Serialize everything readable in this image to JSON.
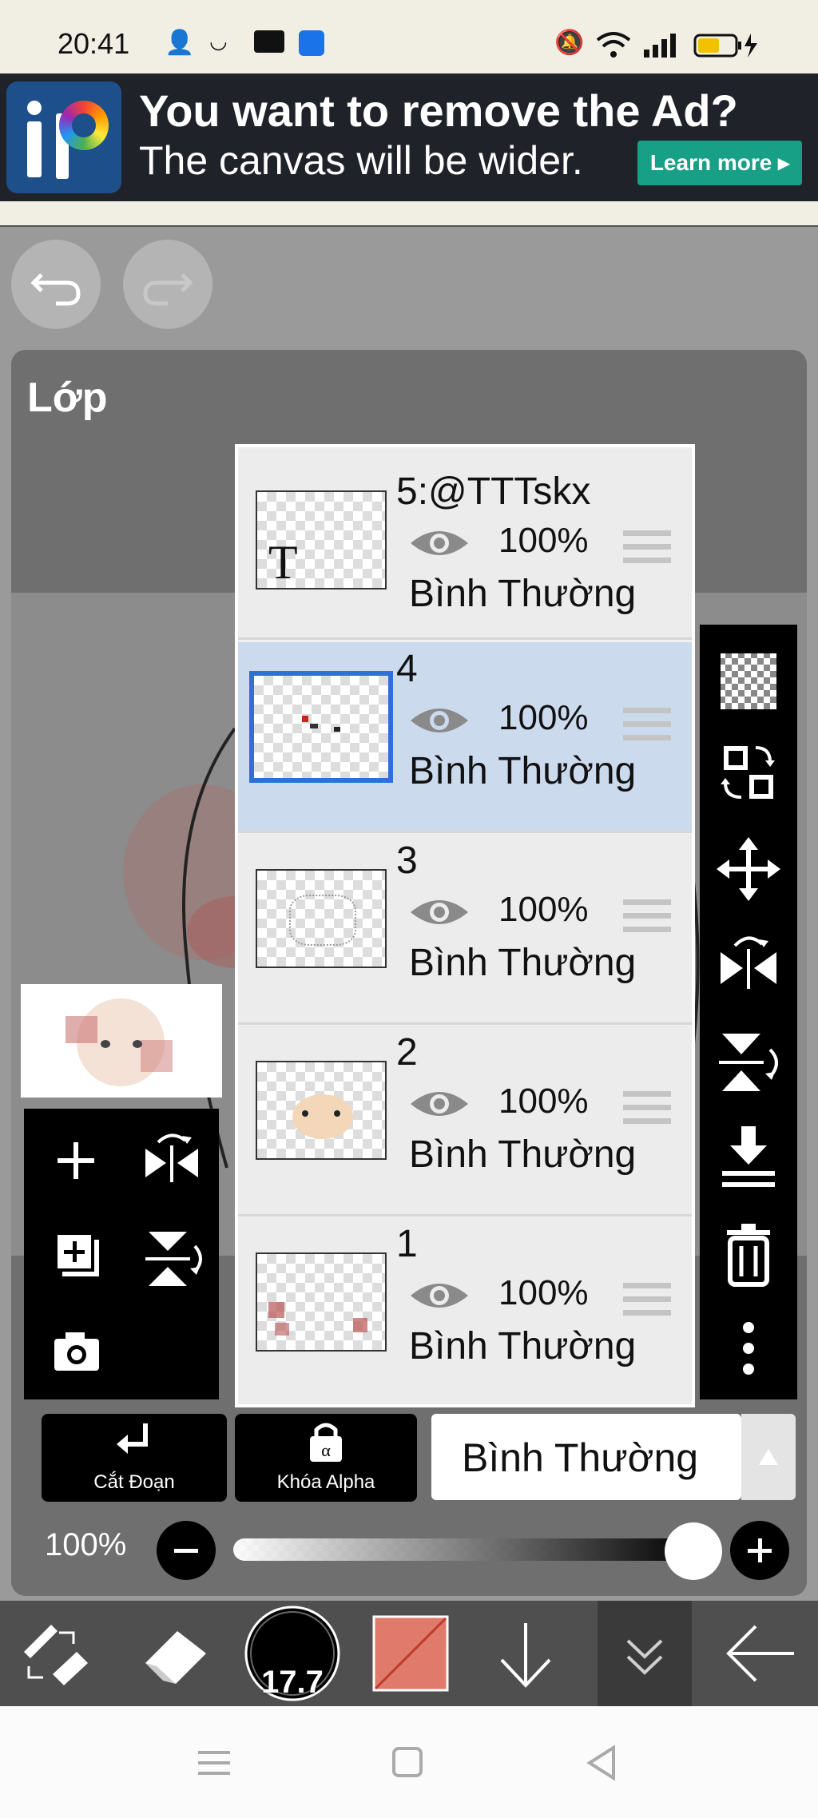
{
  "status_bar": {
    "time": "20:41"
  },
  "ad": {
    "headline": "You want to remove the Ad?",
    "subtext": "The canvas will be wider.",
    "cta": "Learn more ▸"
  },
  "panel": {
    "title": "Lớp"
  },
  "layers": [
    {
      "name": "5:@TTTskx",
      "opacity": "100%",
      "mode": "Bình Thường",
      "thumb_letter": "T",
      "selected": false
    },
    {
      "name": "4",
      "opacity": "100%",
      "mode": "Bình Thường",
      "selected": true
    },
    {
      "name": "3",
      "opacity": "100%",
      "mode": "Bình Thường",
      "selected": false
    },
    {
      "name": "2",
      "opacity": "100%",
      "mode": "Bình Thường",
      "selected": false
    },
    {
      "name": "1",
      "opacity": "100%",
      "mode": "Bình Thường",
      "selected": false
    }
  ],
  "controls": {
    "clipping_label": "Cắt Đoạn",
    "alpha_lock_label": "Khóa Alpha",
    "blend_mode": "Bình Thường",
    "opacity_label": "100%",
    "opacity_value": 1.0,
    "brush_size": "17.7"
  },
  "colors": {
    "accent_selection": "#2e6fd8",
    "selected_layer_bg": "#ccdaee",
    "current_color": "#e07a6a",
    "ad_cta": "#17a085"
  }
}
